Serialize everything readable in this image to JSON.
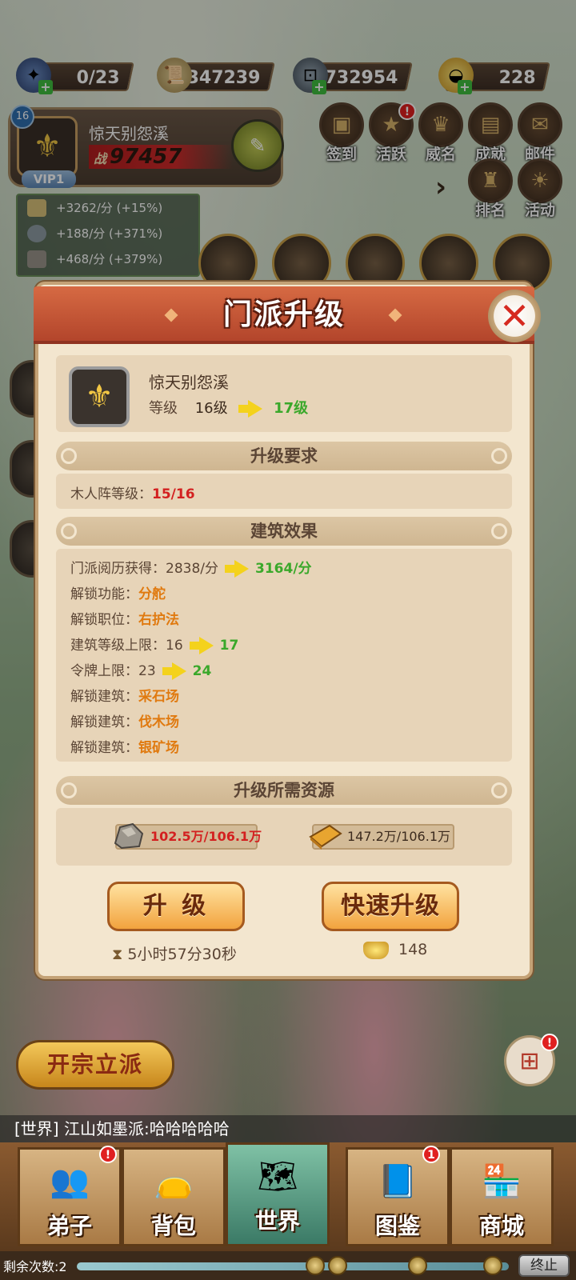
{
  "resources": [
    {
      "name": "token",
      "value": "0/23",
      "icon": "scroll-token-icon"
    },
    {
      "name": "experience",
      "value": "347239",
      "icon": "scroll-icon"
    },
    {
      "name": "copper",
      "value": "732954",
      "icon": "coin-icon"
    },
    {
      "name": "gold",
      "value": "228",
      "icon": "gold-ingot-icon"
    }
  ],
  "profile": {
    "level": "16",
    "name": "惊天别怨溪",
    "power_prefix": "战",
    "power": "97457",
    "vip": "VIP1"
  },
  "menu": [
    {
      "label": "签到",
      "icon": "calendar-icon"
    },
    {
      "label": "活跃",
      "icon": "star-icon",
      "badge": "!"
    },
    {
      "label": "威名",
      "icon": "crown-icon"
    },
    {
      "label": "成就",
      "icon": "book-icon"
    },
    {
      "label": "邮件",
      "icon": "mail-icon"
    },
    {
      "label": "排名",
      "icon": "trophy-icon"
    },
    {
      "label": "活动",
      "icon": "sun-icon"
    }
  ],
  "production": [
    {
      "text": "+3262/分 (+15%)",
      "icon": "scroll-icon"
    },
    {
      "text": "+188/分 (+371%)",
      "icon": "coin-icon"
    },
    {
      "text": "+468/分 (+379%)",
      "icon": "stone-icon"
    }
  ],
  "dialog": {
    "title": "门派升级",
    "sect_name": "惊天别怨溪",
    "level_label": "等级",
    "level_from": "16级",
    "level_to": "17级",
    "req_header": "升级要求",
    "req_label": "木人阵等级：",
    "req_value": "15/16",
    "effects_header": "建筑效果",
    "effects": [
      {
        "label": "门派阅历获得：",
        "from": "2838/分",
        "to": "3164/分"
      },
      {
        "label": "解锁功能：",
        "value": "分舵"
      },
      {
        "label": "解锁职位：",
        "value": "右护法"
      },
      {
        "label": "建筑等级上限：",
        "from": "16",
        "to": "17"
      },
      {
        "label": "令牌上限：",
        "from": "23",
        "to": "24"
      },
      {
        "label": "解锁建筑：",
        "value": "采石场"
      },
      {
        "label": "解锁建筑：",
        "value": "伐木场"
      },
      {
        "label": "解锁建筑：",
        "value": "银矿场"
      }
    ],
    "cost_header": "升级所需资源",
    "cost_stone": "102.5万/106.1万",
    "cost_wood": "147.2万/106.1万",
    "upgrade_label": "升 级",
    "quick_label": "快速升级",
    "time": "5小时57分30秒",
    "gold_cost": "148"
  },
  "bottom": {
    "found_sect": "开宗立派",
    "chat": "[世界] 江山如墨派:哈哈哈哈哈",
    "tabs": [
      {
        "label": "弟子",
        "badge": "!"
      },
      {
        "label": "背包"
      },
      {
        "label": "世界"
      },
      {
        "label": "图鉴",
        "badge": "1"
      },
      {
        "label": "商城"
      }
    ],
    "remaining": "剩余次数:2",
    "end_label": "终止"
  }
}
